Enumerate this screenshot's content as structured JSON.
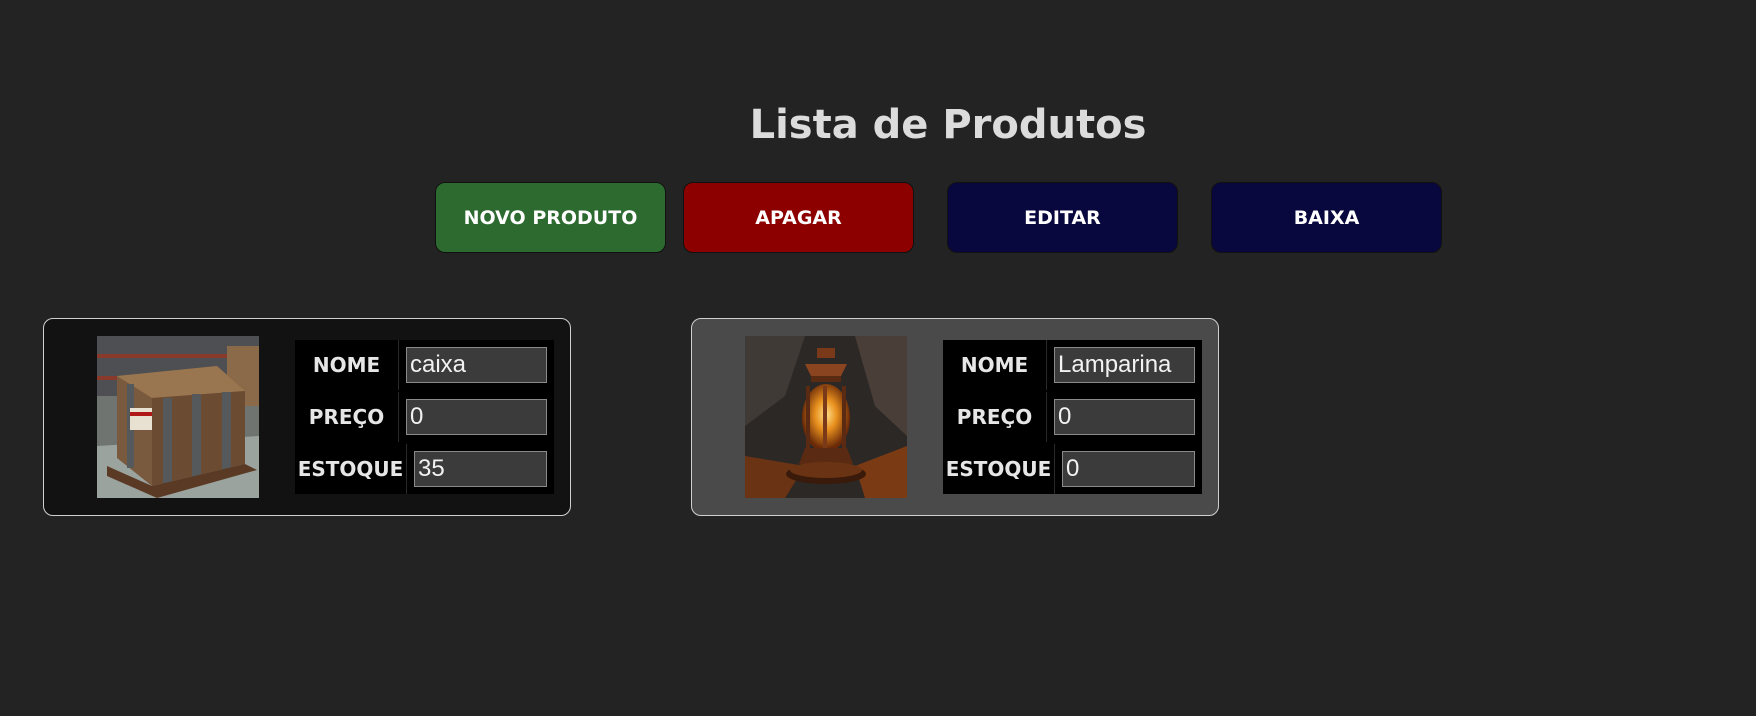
{
  "page": {
    "title": "Lista de Produtos"
  },
  "toolbar": {
    "novo_label": "NOVO PRODUTO",
    "apagar_label": "APAGAR",
    "editar_label": "EDITAR",
    "baixa_label": "BAIXA"
  },
  "colors": {
    "background": "#232323",
    "novo": "#2c6a2f",
    "apagar": "#8c0000",
    "editar": "#08083e",
    "baixa": "#08083e",
    "card_normal": "#121212",
    "card_selected": "#4a4a4a"
  },
  "products": [
    {
      "image_icon": "wooden-crate-image",
      "nome_label": "NOME",
      "nome_value": "caixa",
      "preco_label": "PREÇO",
      "preco_value": "0",
      "estoque_label": "ESTOQUE",
      "estoque_value": "35"
    },
    {
      "image_icon": "oil-lamp-image",
      "nome_label": "NOME",
      "nome_value": "Lamparina",
      "preco_label": "PREÇO",
      "preco_value": "0",
      "estoque_label": "ESTOQUE",
      "estoque_value": "0"
    }
  ]
}
